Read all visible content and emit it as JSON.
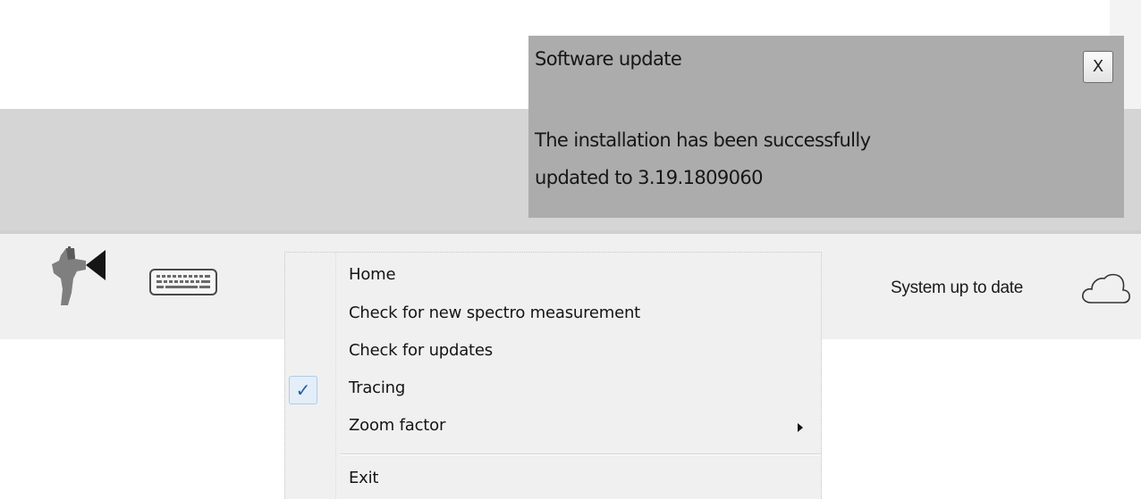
{
  "notification": {
    "title": "Software update",
    "message_line1": "The installation has been successfully",
    "message_line2": "updated to 3.19.1809060",
    "close_label": "X",
    "background": "#acacac"
  },
  "taskbar": {
    "app_icon": "spray-gun-icon",
    "keyboard_icon": "keyboard-icon",
    "status_text": "System up to date",
    "status_icon": "cloud-icon"
  },
  "context_menu": {
    "items": [
      {
        "label": "Home",
        "checked": false,
        "has_submenu": false
      },
      {
        "label": "Check for new spectro measurement",
        "checked": false,
        "has_submenu": false
      },
      {
        "label": "Check for updates",
        "checked": false,
        "has_submenu": false
      },
      {
        "label": "Tracing",
        "checked": true,
        "has_submenu": false
      },
      {
        "label": "Zoom factor",
        "checked": false,
        "has_submenu": true
      },
      {
        "label": "Exit",
        "checked": false,
        "has_submenu": false
      }
    ],
    "check_glyph": "✓"
  }
}
